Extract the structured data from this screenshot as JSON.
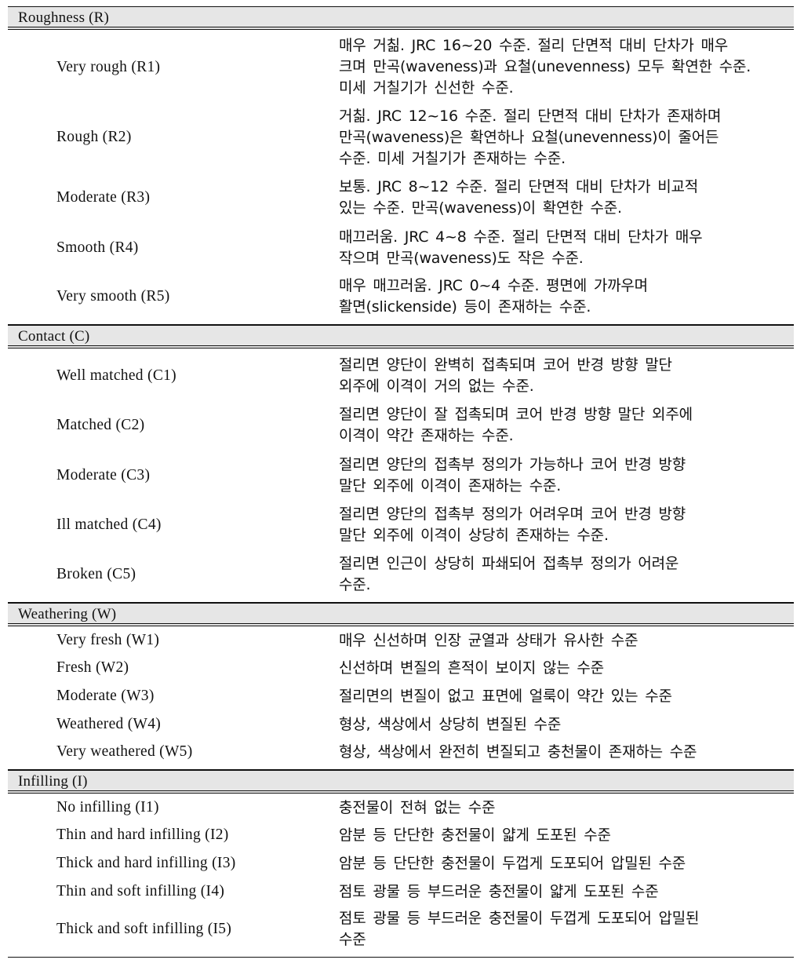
{
  "sections": [
    {
      "title": "Roughness (R)",
      "rows": [
        {
          "term": "Very rough (R1)",
          "desc": [
            "매우 거칢. JRC 16~20 수준. 절리 단면적 대비 단차가 매우",
            "크며 만곡(waveness)과 요철(unevenness) 모두 확연한 수준.",
            "미세 거칠기가 신선한 수준."
          ]
        },
        {
          "term": "Rough (R2)",
          "desc": [
            "거칢. JRC 12~16 수준. 절리 단면적 대비 단차가 존재하며",
            "만곡(waveness)은 확연하나 요철(unevenness)이 줄어든",
            "수준. 미세 거칠기가 존재하는 수준."
          ]
        },
        {
          "term": "Moderate (R3)",
          "desc": [
            "보통. JRC 8~12 수준. 절리 단면적 대비 단차가 비교적",
            "있는 수준. 만곡(waveness)이 확연한 수준."
          ]
        },
        {
          "term": "Smooth (R4)",
          "desc": [
            "매끄러움. JRC 4~8 수준. 절리 단면적 대비 단차가 매우",
            "작으며 만곡(waveness)도 작은 수준."
          ]
        },
        {
          "term": "Very smooth (R5)",
          "desc": [
            "매우 매끄러움. JRC 0~4 수준. 평면에 가까우며",
            "활면(slickenside) 등이 존재하는 수준."
          ]
        }
      ]
    },
    {
      "title": "Contact (C)",
      "rows": [
        {
          "term": "Well matched (C1)",
          "desc": [
            "절리면 양단이 완벽히 접촉되며 코어 반경 방향 말단",
            "외주에 이격이 거의 없는 수준."
          ]
        },
        {
          "term": "Matched (C2)",
          "desc": [
            "절리면 양단이 잘 접촉되며 코어 반경 방향 말단 외주에",
            "이격이 약간 존재하는 수준."
          ]
        },
        {
          "term": "Moderate (C3)",
          "desc": [
            "절리면 양단의 접촉부 정의가 가능하나 코어 반경 방향",
            "말단 외주에 이격이 존재하는 수준."
          ]
        },
        {
          "term": "Ill matched (C4)",
          "desc": [
            "절리면 양단의 접촉부 정의가 어려우며 코어 반경 방향",
            "말단 외주에 이격이 상당히 존재하는 수준."
          ]
        },
        {
          "term": "Broken (C5)",
          "desc": [
            "절리면 인근이 상당히 파쇄되어 접촉부 정의가 어려운",
            "수준."
          ]
        }
      ]
    },
    {
      "title": "Weathering (W)",
      "rows": [
        {
          "term": "Very fresh (W1)",
          "desc": [
            "매우 신선하며 인장 균열과 상태가 유사한 수준"
          ]
        },
        {
          "term": "Fresh (W2)",
          "desc": [
            "신선하며 변질의 흔적이 보이지 않는 수준"
          ]
        },
        {
          "term": "Moderate (W3)",
          "desc": [
            "절리면의 변질이 없고 표면에 얼룩이 약간 있는 수준"
          ]
        },
        {
          "term": "Weathered (W4)",
          "desc": [
            "형상, 색상에서 상당히 변질된 수준"
          ]
        },
        {
          "term": "Very weathered (W5)",
          "desc": [
            "형상, 색상에서 완전히 변질되고 충천물이 존재하는 수준"
          ]
        }
      ]
    },
    {
      "title": "Infilling (I)",
      "rows": [
        {
          "term": "No infilling (I1)",
          "desc": [
            "충전물이 전혀 없는 수준"
          ]
        },
        {
          "term": "Thin and hard infilling (I2)",
          "desc": [
            "암분 등 단단한 충전물이 얇게 도포된 수준"
          ]
        },
        {
          "term": "Thick and hard infilling (I3)",
          "desc": [
            "암분 등 단단한 충전물이 두껍게 도포되어 압밀된 수준"
          ]
        },
        {
          "term": "Thin and soft infilling (I4)",
          "desc": [
            "점토 광물 등 부드러운 충전물이 얇게 도포된 수준"
          ]
        },
        {
          "term": "Thick and soft infilling (I5)",
          "desc": [
            "점토 광물 등 부드러운 충전물이 두껍게 도포되어 압밀된",
            "수준"
          ]
        }
      ]
    }
  ]
}
